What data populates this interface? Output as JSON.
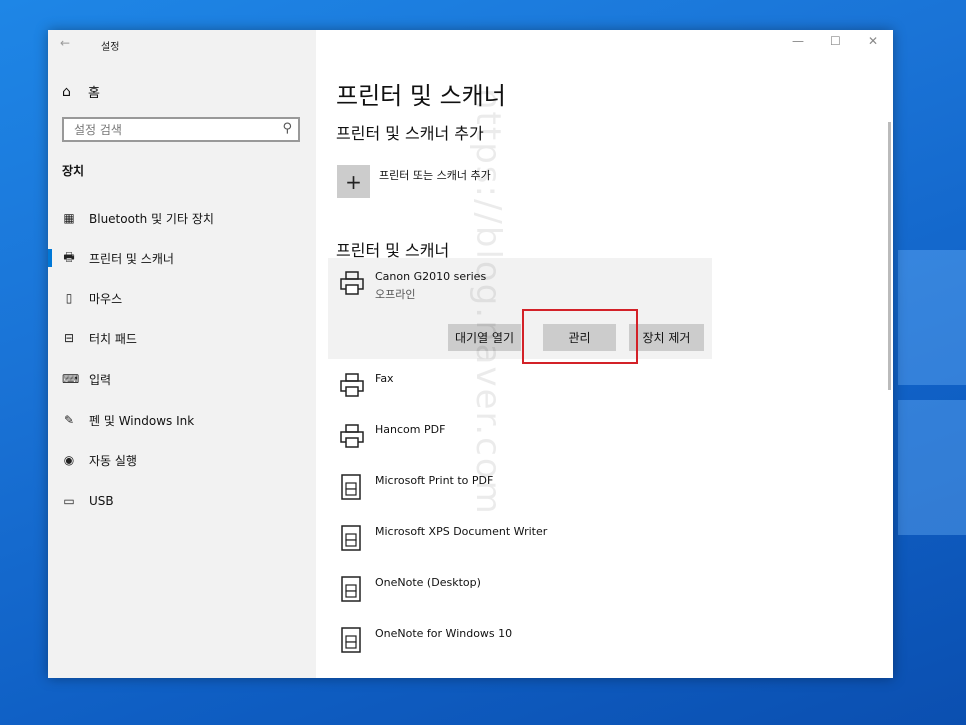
{
  "window": {
    "back_glyph": "←",
    "title": "설정",
    "controls": {
      "minimize": "—",
      "maximize": "☐",
      "close": "✕"
    }
  },
  "sidebar": {
    "home": {
      "label": "홈",
      "icon": "home-icon"
    },
    "search": {
      "placeholder": "설정 검색",
      "icon": "search-icon"
    },
    "section": "장치",
    "items": [
      {
        "label": "Bluetooth 및 기타 장치",
        "icon": "bluetooth-devices-icon",
        "active": false
      },
      {
        "label": "프린터 및 스캐너",
        "icon": "printer-icon",
        "active": true
      },
      {
        "label": "마우스",
        "icon": "mouse-icon",
        "active": false
      },
      {
        "label": "터치 패드",
        "icon": "touchpad-icon",
        "active": false
      },
      {
        "label": "입력",
        "icon": "keyboard-icon",
        "active": false
      },
      {
        "label": "펜 및 Windows Ink",
        "icon": "pen-icon",
        "active": false
      },
      {
        "label": "자동 실행",
        "icon": "autoplay-icon",
        "active": false
      },
      {
        "label": "USB",
        "icon": "usb-icon",
        "active": false
      }
    ]
  },
  "main": {
    "page_title": "프린터 및 스캐너",
    "add_section_title": "프린터 및 스캐너 추가",
    "add_button_label": "프린터 또는 스캐너 추가",
    "list_title": "프린터 및 스캐너",
    "selected": {
      "name": "Canon G2010 series",
      "status": "오프라인",
      "buttons": [
        "대기열 열기",
        "관리",
        "장치 제거"
      ]
    },
    "devices": [
      {
        "name": "Fax",
        "icon": "printer-icon"
      },
      {
        "name": "Hancom PDF",
        "icon": "printer-icon"
      },
      {
        "name": "Microsoft Print to PDF",
        "icon": "document-printer-icon"
      },
      {
        "name": "Microsoft XPS Document Writer",
        "icon": "document-printer-icon"
      },
      {
        "name": "OneNote (Desktop)",
        "icon": "document-printer-icon"
      },
      {
        "name": "OneNote for Windows 10",
        "icon": "document-printer-icon"
      }
    ]
  },
  "watermark": "https://blog.naver.com",
  "colors": {
    "accent": "#0078d7",
    "highlight": "#d32128"
  }
}
